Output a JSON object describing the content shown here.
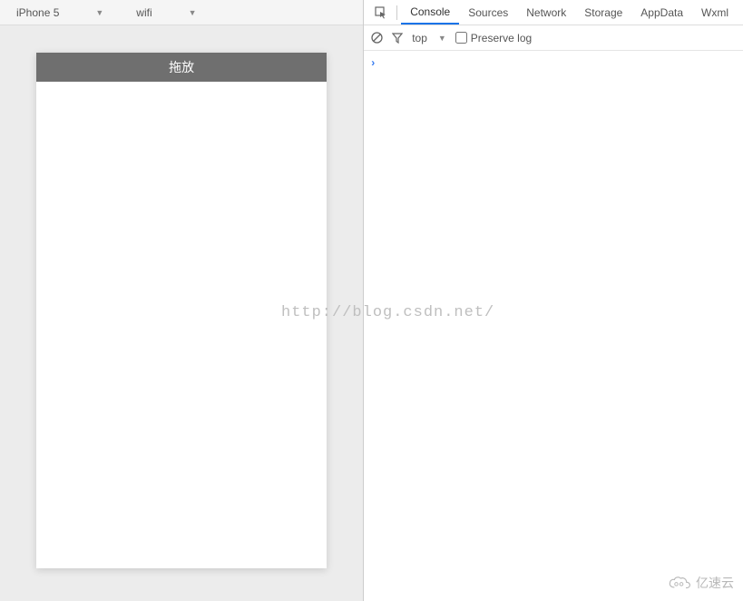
{
  "emulator": {
    "device": "iPhone 5",
    "network": "wifi"
  },
  "phone": {
    "header_title": "拖放"
  },
  "devtools": {
    "tabs": {
      "console": "Console",
      "sources": "Sources",
      "network": "Network",
      "storage": "Storage",
      "appdata": "AppData",
      "wxml": "Wxml"
    },
    "console_toolbar": {
      "context": "top",
      "preserve_log_label": "Preserve log"
    },
    "prompt": ">"
  },
  "watermark": "http://blog.csdn.net/",
  "corner_logo_text": "亿速云"
}
